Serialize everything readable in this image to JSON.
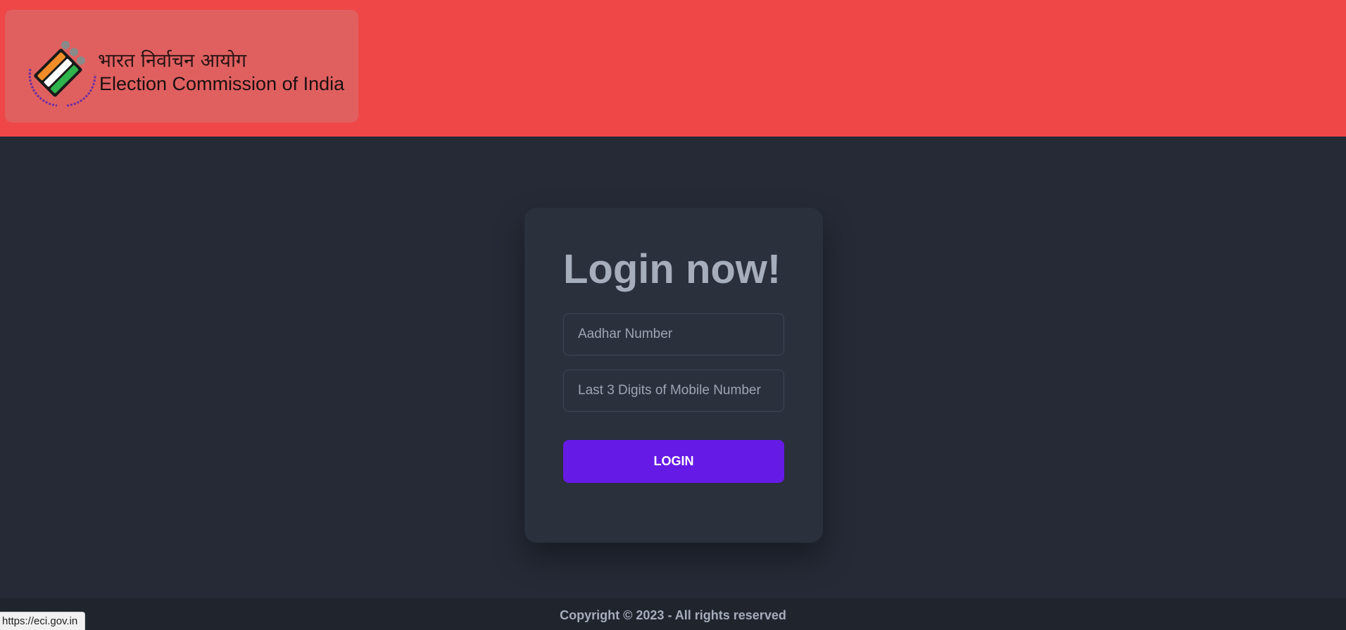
{
  "header": {
    "logo": {
      "hindi_text": "भारत निर्वाचन आयोग",
      "english_text": "Election Commission of India",
      "emblem_icon": "ballot-emblem-icon",
      "emblem_colors": [
        "#f28c28",
        "#ffffff",
        "#2fb34a",
        "#1a1a1a"
      ],
      "emblem_ring_text_color": "#6a2fa0"
    },
    "background_color": "#ef4747"
  },
  "login": {
    "title": "Login now!",
    "aadhar": {
      "value": "",
      "placeholder": "Aadhar Number"
    },
    "mobile": {
      "value": "",
      "placeholder": "Last 3 Digits of Mobile Number"
    },
    "button_label": "LOGIN",
    "button_color": "#661ae6"
  },
  "footer": {
    "copyright": "Copyright © 2023 - All rights reserved"
  },
  "browser": {
    "status_url": "https://eci.gov.in"
  },
  "colors": {
    "page_background": "#252a36",
    "card_background": "#2a303c",
    "text_muted": "#a6adbb"
  }
}
